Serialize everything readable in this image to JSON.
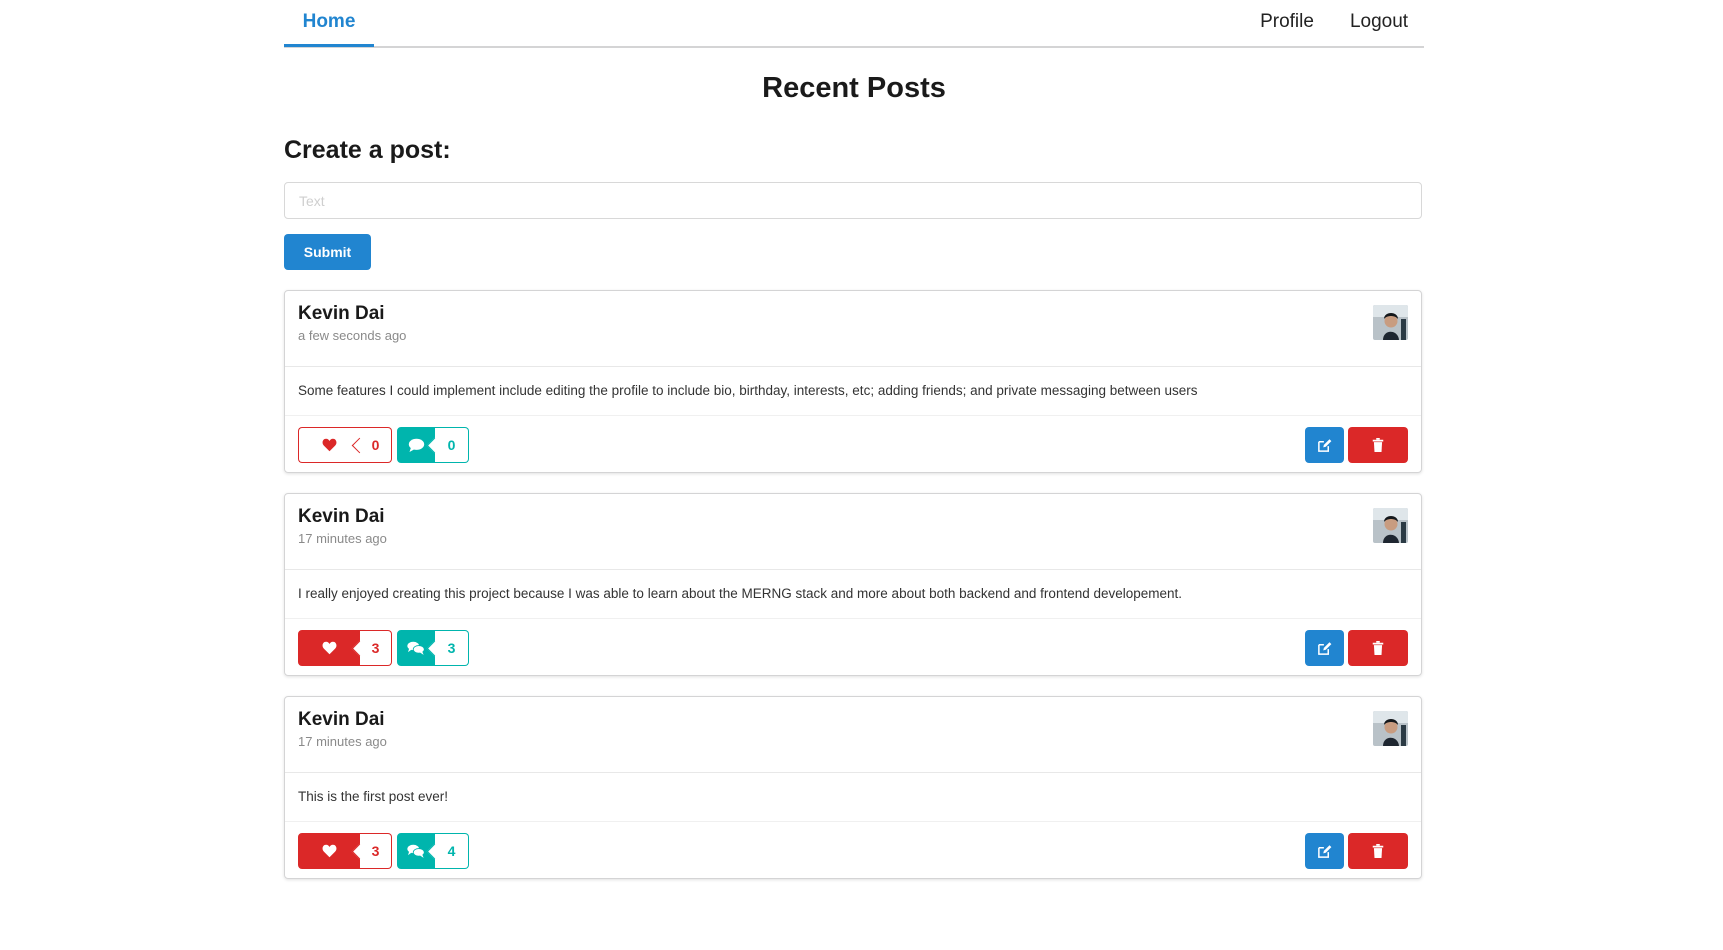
{
  "nav": {
    "home": "Home",
    "profile": "Profile",
    "logout": "Logout"
  },
  "page_title": "Recent Posts",
  "create": {
    "title": "Create a post:",
    "placeholder": "Text",
    "value": "",
    "submit_label": "Submit"
  },
  "colors": {
    "primary": "#2185d0",
    "like": "#db2828",
    "comment": "#00b5ad"
  },
  "icons": {
    "like": "heart-icon",
    "comment_empty": "comment-icon",
    "comment_many": "comments-icon",
    "edit": "edit-icon",
    "delete": "trash-icon"
  },
  "posts": [
    {
      "author": "Kevin Dai",
      "time": "a few seconds ago",
      "body": "Some features I could implement include editing the profile to include bio, birthday, interests, etc; adding friends; and private messaging between users",
      "likes": "0",
      "comments": "0",
      "liked": false
    },
    {
      "author": "Kevin Dai",
      "time": "17 minutes ago",
      "body": "I really enjoyed creating this project because I was able to learn about the MERNG stack and more about both backend and frontend developement.",
      "likes": "3",
      "comments": "3",
      "liked": true
    },
    {
      "author": "Kevin Dai",
      "time": "17 minutes ago",
      "body": "This is the first post ever!",
      "likes": "3",
      "comments": "4",
      "liked": true
    }
  ]
}
